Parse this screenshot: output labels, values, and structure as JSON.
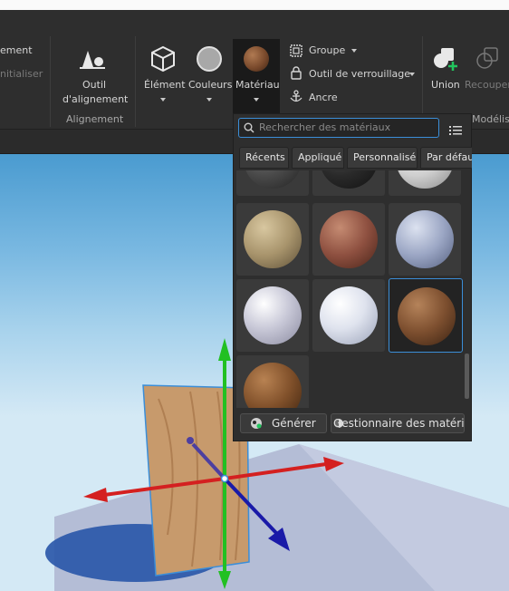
{
  "ribbon": {
    "partial_left_top": "ement",
    "partial_left_bottom": "nitialiser",
    "alignment_tool_line1": "Outil",
    "alignment_tool_line2": "d'alignement",
    "alignment_group": "Alignement",
    "element_label": "Élément",
    "colors_label": "Couleurs",
    "material_label": "Matériau",
    "group_label": "Groupe",
    "lock_tool_label": "Outil de verrouillage",
    "anchor_label": "Ancre",
    "union_label": "Union",
    "recouper_label": "Recouper",
    "modelisation_label": "Modélisa"
  },
  "material_panel": {
    "search_placeholder": "Rechercher des matériaux",
    "tabs": [
      "Récents",
      "Appliqué",
      "Personnalisé",
      "Par défaut"
    ],
    "generate_label": "Générer",
    "manager_label": "Gestionnaire des matériaux",
    "materials": [
      "slate",
      "basalt",
      "snow-rough",
      "sandstone",
      "brick",
      "glacier",
      "smooth-plastic",
      "snow",
      "wood-planks",
      "wood"
    ]
  },
  "colors": {
    "accent": "#3b8ed8",
    "ribbon_bg": "#2e2e2e",
    "sky_top": "#4a9bd0",
    "axis_y": "#22c022",
    "axis_x": "#d42020",
    "axis_z": "#1a1aa8"
  }
}
